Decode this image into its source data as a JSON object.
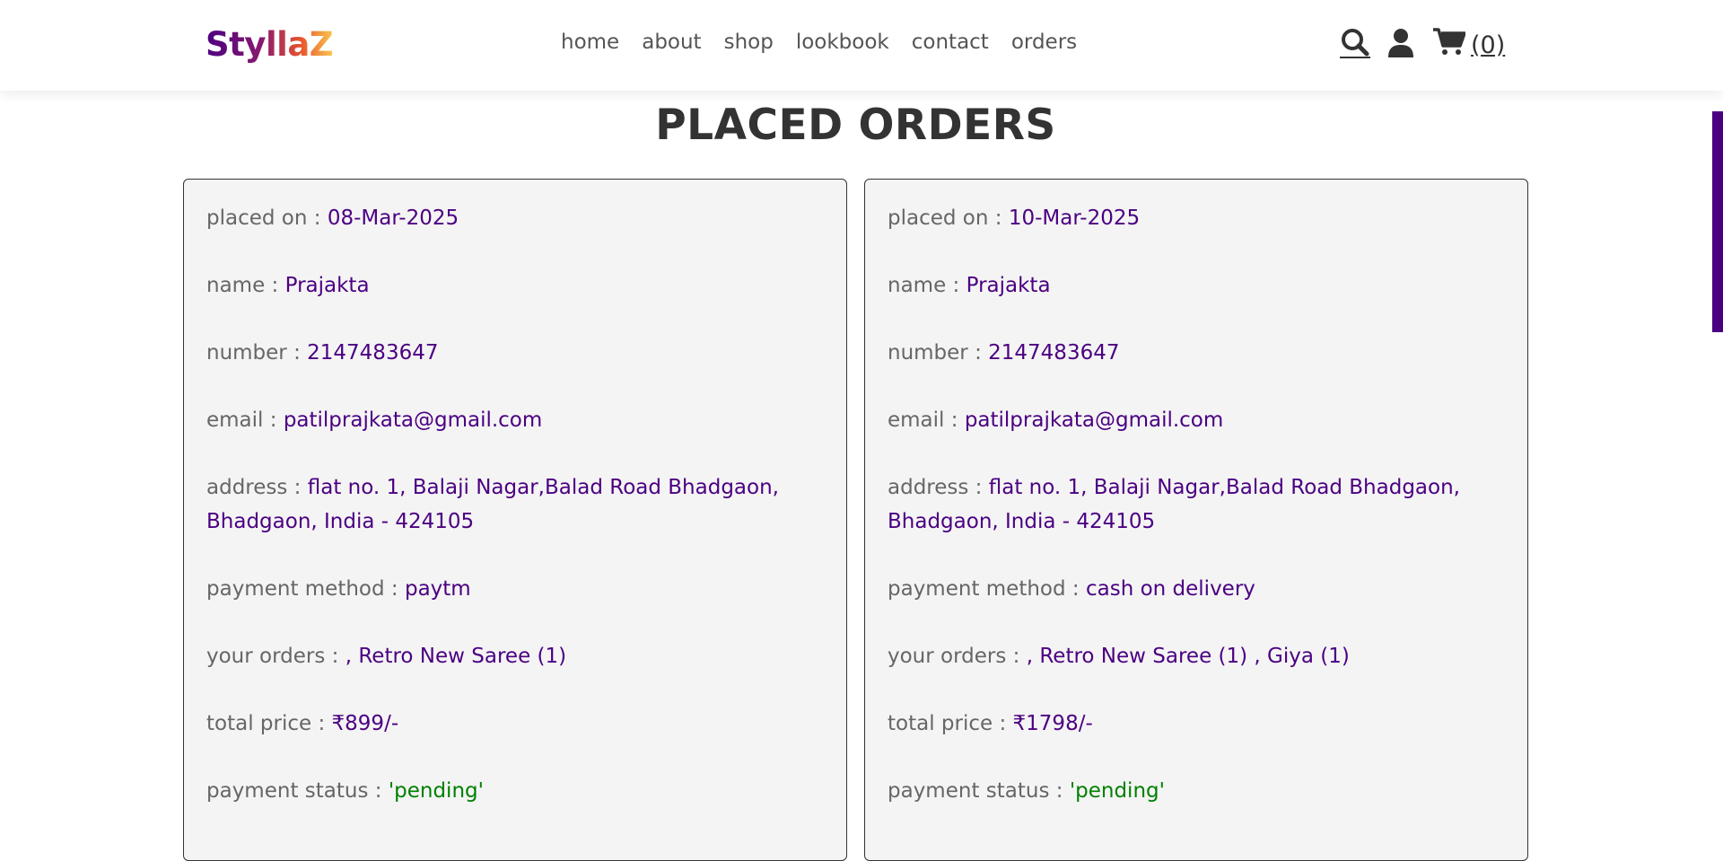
{
  "header": {
    "logo": "StyllaZ",
    "nav": [
      "home",
      "about",
      "shop",
      "lookbook",
      "contact",
      "orders"
    ],
    "cart_count": "(0)",
    "icons": [
      "search-icon",
      "user-icon",
      "cart-icon"
    ]
  },
  "page": {
    "title": "PLACED ORDERS"
  },
  "labels": {
    "placed_on": "placed on : ",
    "name": "name : ",
    "number": "number : ",
    "email": "email : ",
    "address": "address : ",
    "payment_method": "payment method : ",
    "your_orders": "your orders : ",
    "total_price": "total price : ",
    "payment_status": "payment status : "
  },
  "orders": [
    {
      "placed_on": "08-Mar-2025",
      "name": "Prajakta",
      "number": "2147483647",
      "email": "patilprajkata@gmail.com",
      "address": "flat no. 1, Balaji Nagar,Balad Road Bhadgaon, Bhadgaon, India - 424105",
      "payment_method": "paytm",
      "your_orders": ", Retro New Saree (1)",
      "total_price": "₹899/-",
      "payment_status": "'pending'"
    },
    {
      "placed_on": "10-Mar-2025",
      "name": "Prajakta",
      "number": "2147483647",
      "email": "patilprajkata@gmail.com",
      "address": "flat no. 1, Balaji Nagar,Balad Road Bhadgaon, Bhadgaon, India - 424105",
      "payment_method": "cash on delivery",
      "your_orders": ", Retro New Saree (1) , Giya (1)",
      "total_price": "₹1798/-",
      "payment_status": "'pending'"
    }
  ],
  "colors": {
    "accent": "#4b0082",
    "status": "#008000",
    "text": "#666666",
    "card_bg": "#f4f4f4"
  }
}
